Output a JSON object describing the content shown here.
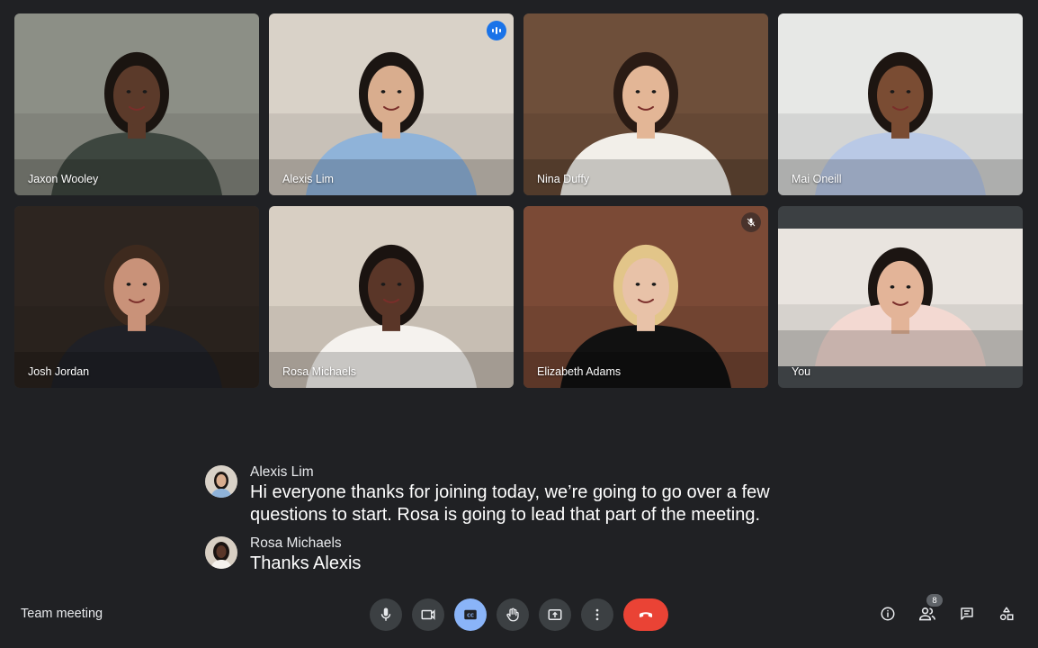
{
  "participants": [
    {
      "name": "Jaxon Wooley",
      "status": "",
      "bg": "#8c8f86",
      "shirt": "#3d463f",
      "skin": "#5b3a2a",
      "hair": "#1a1410"
    },
    {
      "name": "Alexis Lim",
      "status": "speaking",
      "bg": "#d9d2c8",
      "shirt": "#8fb3d9",
      "skin": "#d9ad8e",
      "hair": "#1b1512"
    },
    {
      "name": "Nina Duffy",
      "status": "",
      "bg": "#6e4f3a",
      "shirt": "#f2efe9",
      "skin": "#e3b696",
      "hair": "#2a1b14"
    },
    {
      "name": "Mai Oneill",
      "status": "",
      "bg": "#e7e8e6",
      "shirt": "#b9c9e6",
      "skin": "#7a4c33",
      "hair": "#1d1511"
    },
    {
      "name": "Josh Jordan",
      "status": "",
      "bg": "#2d2520",
      "shirt": "#1f2026",
      "skin": "#c99279",
      "hair": "#3e2a1e"
    },
    {
      "name": "Rosa Michaels",
      "status": "",
      "bg": "#d8cfc3",
      "shirt": "#f5f2ee",
      "skin": "#5a3628",
      "hair": "#1a1310"
    },
    {
      "name": "Elizabeth Adams",
      "status": "muted",
      "bg": "#7b4a36",
      "shirt": "#111111",
      "skin": "#e8c2a8",
      "hair": "#e2c589"
    },
    {
      "name": "You",
      "status": "",
      "bg": "#e9e4df",
      "shirt": "#f3d9d2",
      "skin": "#e3b498",
      "hair": "#1c1512"
    }
  ],
  "captions": [
    {
      "speaker": "Alexis Lim",
      "text": "Hi everyone thanks for joining today, we’re going to go over a few questions to start. Rosa is going to lead that part of the meeting."
    },
    {
      "speaker": "Rosa Michaels",
      "text": "Thanks Alexis"
    }
  ],
  "meeting": {
    "name": "Team meeting"
  },
  "controls": [
    {
      "id": "mic",
      "icon": "mic-icon",
      "state": "on"
    },
    {
      "id": "camera",
      "icon": "videocam-icon",
      "state": "on"
    },
    {
      "id": "captions",
      "icon": "closed-caption-icon",
      "state": "active"
    },
    {
      "id": "raise-hand",
      "icon": "hand-icon",
      "state": "off"
    },
    {
      "id": "present",
      "icon": "present-screen-icon",
      "state": "off"
    },
    {
      "id": "more",
      "icon": "more-vert-icon",
      "state": "off"
    },
    {
      "id": "leave",
      "icon": "call-end-icon",
      "state": "end"
    }
  ],
  "people_count": "8",
  "colors": {
    "background": "#202124",
    "accent": "#8ab4f8",
    "end_call": "#ea4335",
    "speaking": "#1a73e8"
  }
}
